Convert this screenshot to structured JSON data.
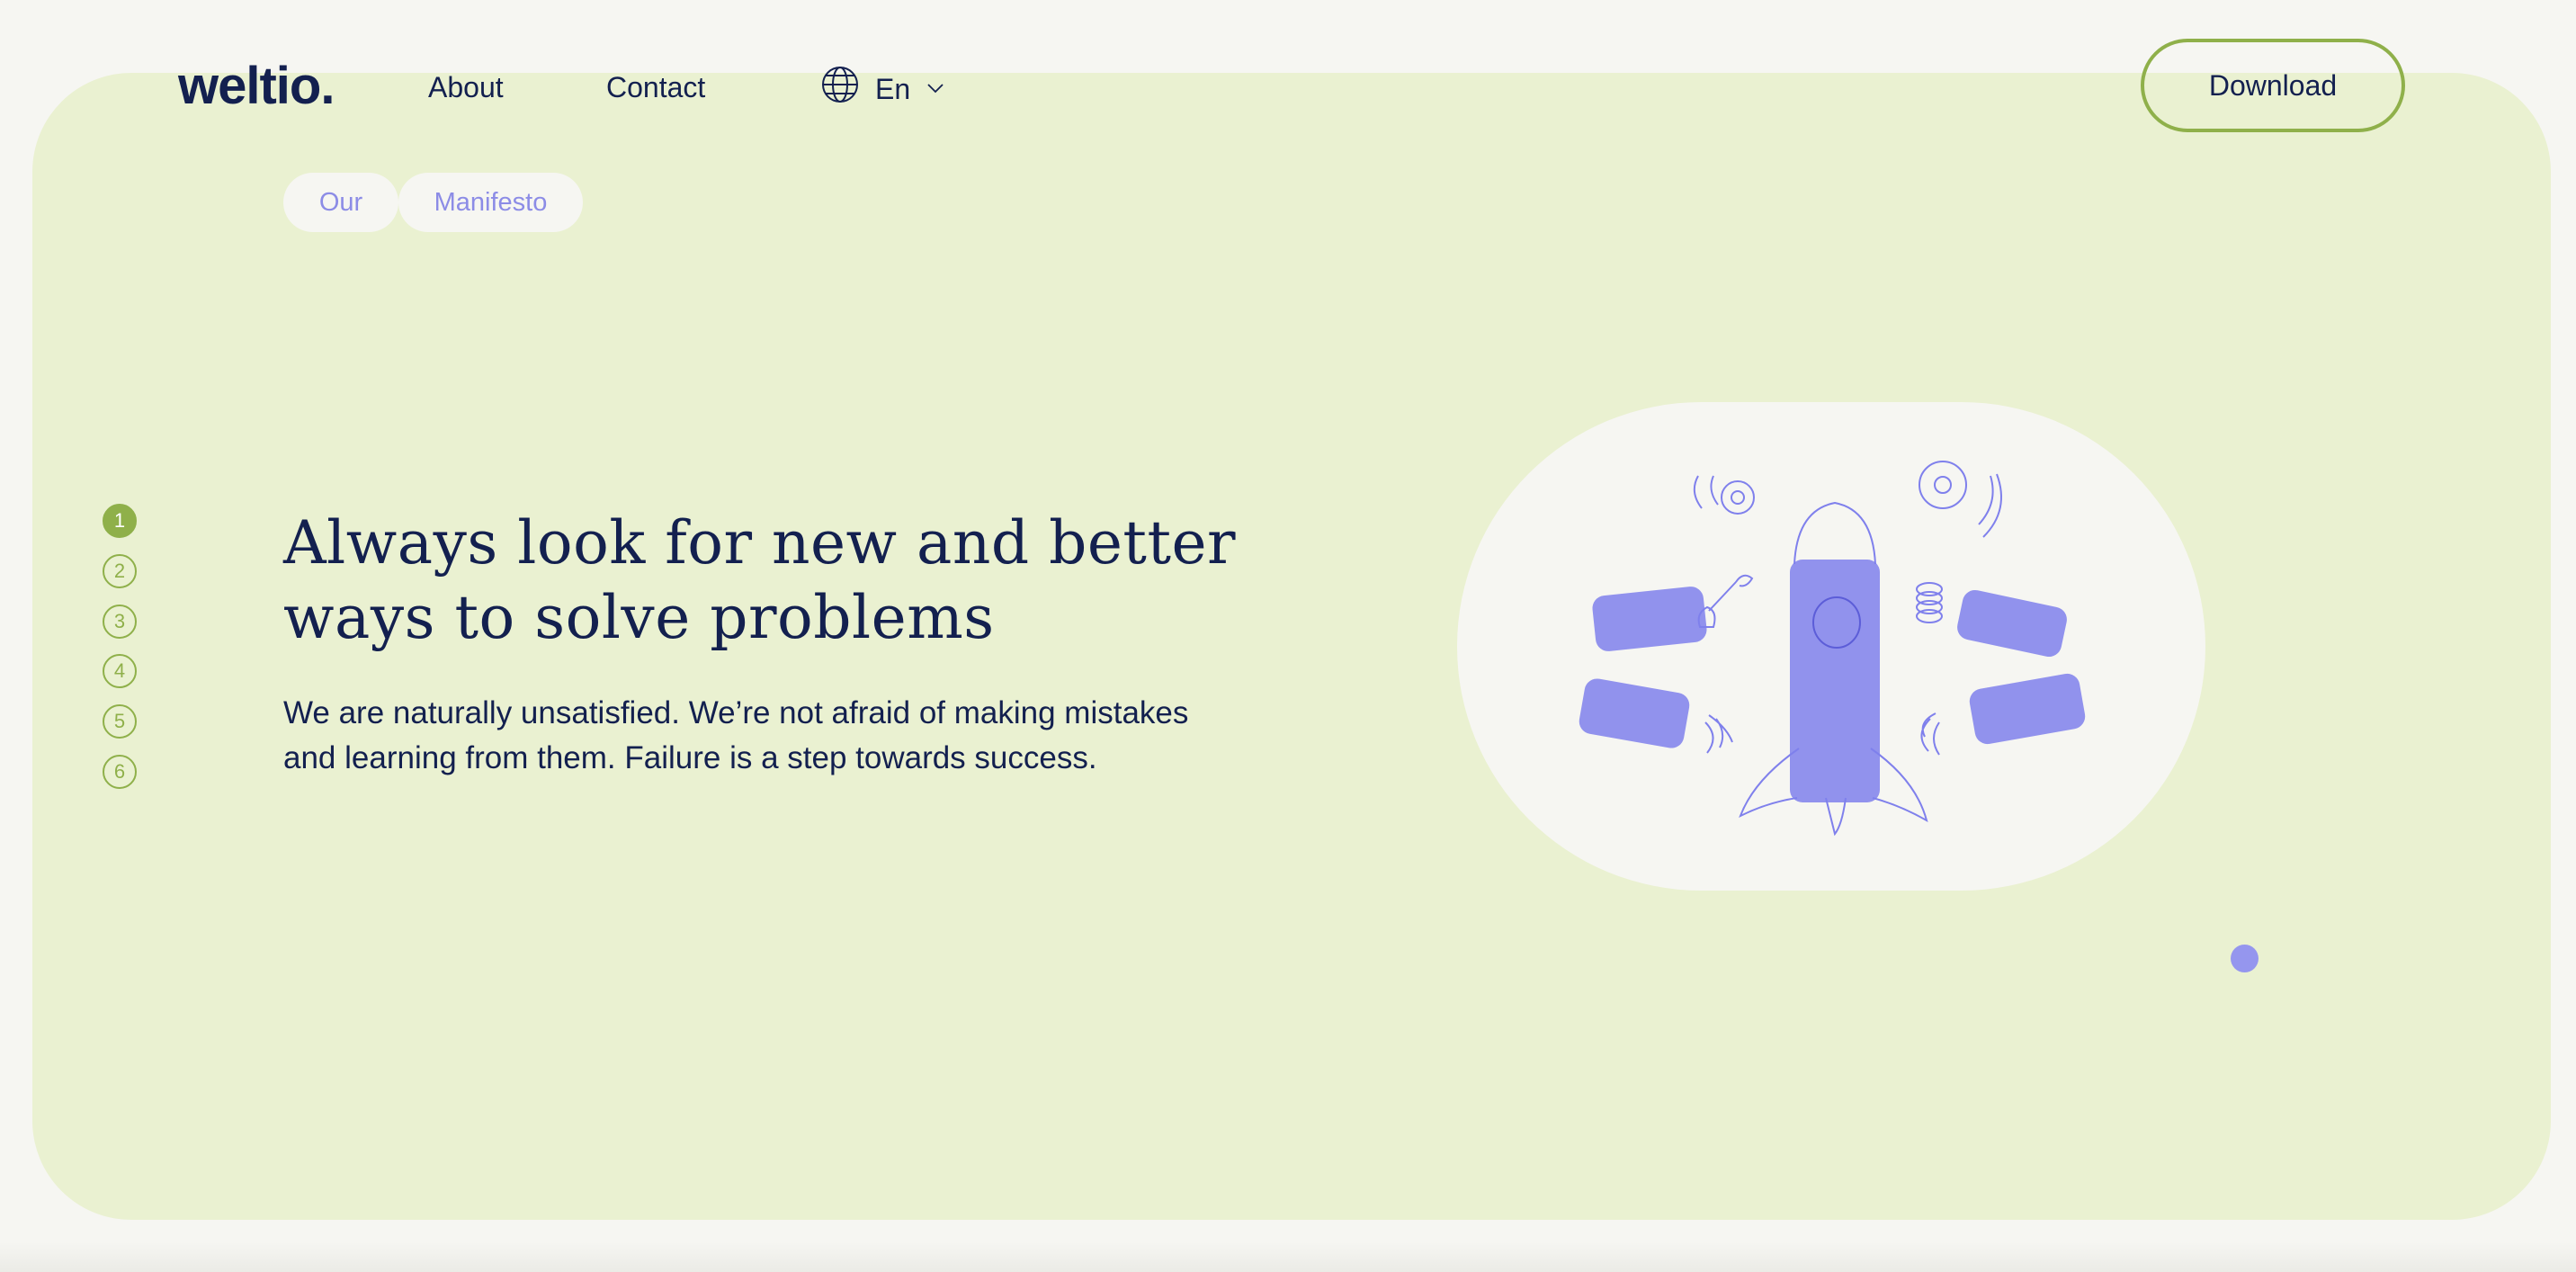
{
  "header": {
    "logo": "weltio.",
    "nav": {
      "about": "About",
      "contact": "Contact"
    },
    "language": {
      "label": "En",
      "icon": "globe-icon",
      "chevron": "chevron-down-icon"
    },
    "download_label": "Download"
  },
  "section": {
    "tags": [
      "Our",
      "Manifesto"
    ],
    "steps": [
      "1",
      "2",
      "3",
      "4",
      "5",
      "6"
    ],
    "active_step": "1",
    "headline": "Always look for new and better ways to solve problems",
    "body": "We are naturally unsatisfied. We’re not afraid of making mistakes and learning from them. Failure is a step towards success.",
    "illustration": "rocket-with-hands-illustration"
  },
  "colors": {
    "page_bg": "#f6f6f2",
    "hero_bg": "#eaf1d1",
    "navy": "#13204f",
    "accent_green": "#8fb04a",
    "illustration_purple": "#7f80ec",
    "pill_text": "#8c8ce6"
  }
}
